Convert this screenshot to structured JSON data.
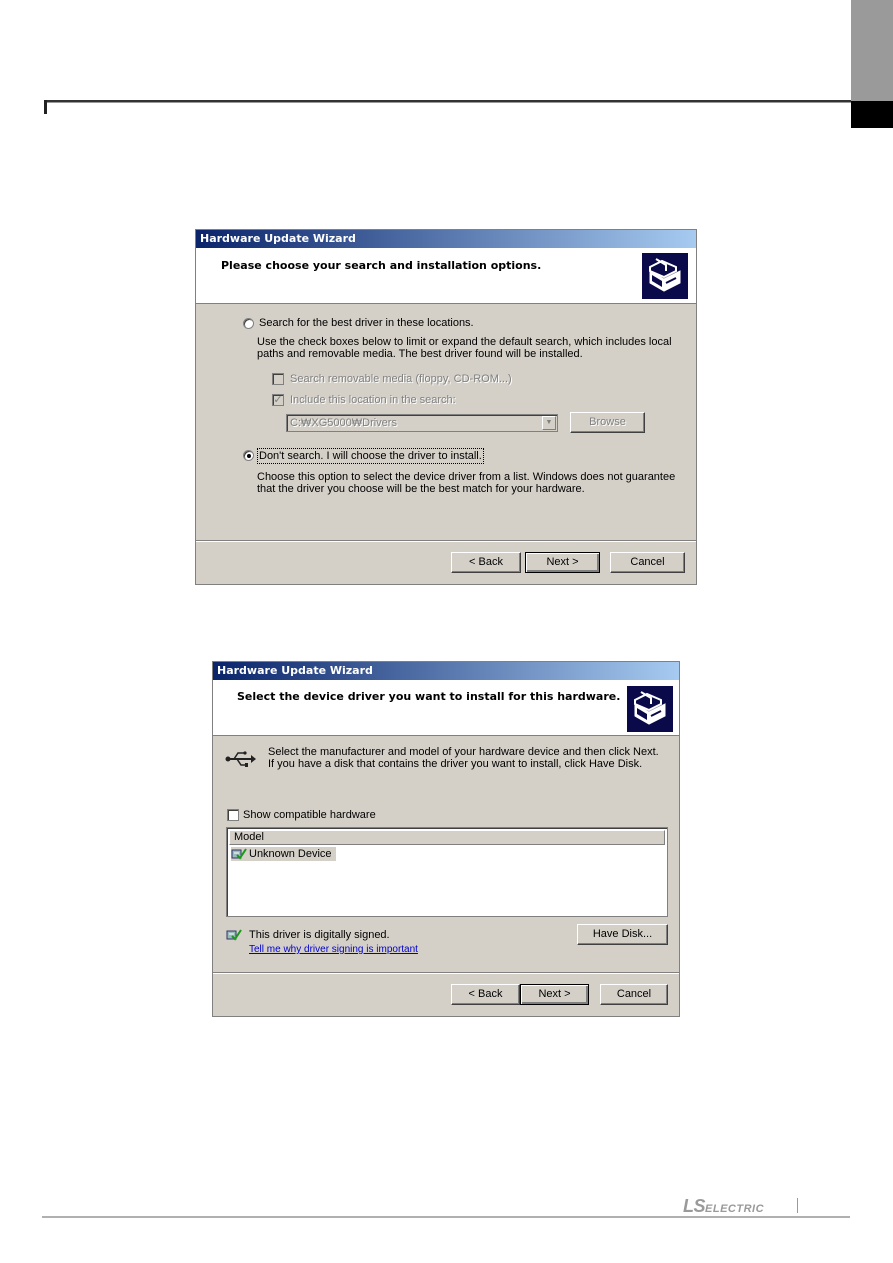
{
  "page": {
    "footer_logo_main": "LS",
    "footer_logo_sub": "ELECTRIC"
  },
  "dialog1": {
    "title": "Hardware Update Wizard",
    "heading": "Please choose your search and installation options.",
    "option_search": {
      "label": "Search for the best driver in these locations.",
      "selected": false,
      "description": "Use the check boxes below to limit or expand the default search, which includes local paths and removable media. The best driver found will be installed."
    },
    "checkbox_removable": {
      "label": "Search removable media (floppy, CD-ROM...)",
      "checked": false,
      "enabled": false
    },
    "checkbox_location": {
      "label": "Include this location in the search:",
      "checked": true,
      "enabled": false
    },
    "location_path": "C:\\XG5000\\Drivers",
    "location_path_display": "C:₩XG5000₩Drivers",
    "browse_label": "Browse",
    "option_dont_search": {
      "label": "Don't search. I will choose the driver to install.",
      "selected": true,
      "description": "Choose this option to select the device driver from a list.  Windows does not guarantee that the driver you choose will be the best match for your hardware."
    },
    "buttons": {
      "back": "< Back",
      "next": "Next >",
      "cancel": "Cancel"
    }
  },
  "dialog2": {
    "title": "Hardware Update Wizard",
    "heading": "Select the device driver you want to install for this hardware.",
    "instruction": "Select the manufacturer and model of your hardware device and then click Next. If you have a disk that contains the driver you want to install, click Have Disk.",
    "show_compatible": {
      "label": "Show compatible hardware",
      "checked": false
    },
    "list": {
      "column_header": "Model",
      "items": [
        {
          "label": "Unknown Device",
          "selected": true
        }
      ]
    },
    "signed_text": "This driver is digitally signed.",
    "signing_link": "Tell me why driver signing is important",
    "have_disk_label": "Have Disk...",
    "buttons": {
      "back": "< Back",
      "next": "Next >",
      "cancel": "Cancel"
    }
  }
}
